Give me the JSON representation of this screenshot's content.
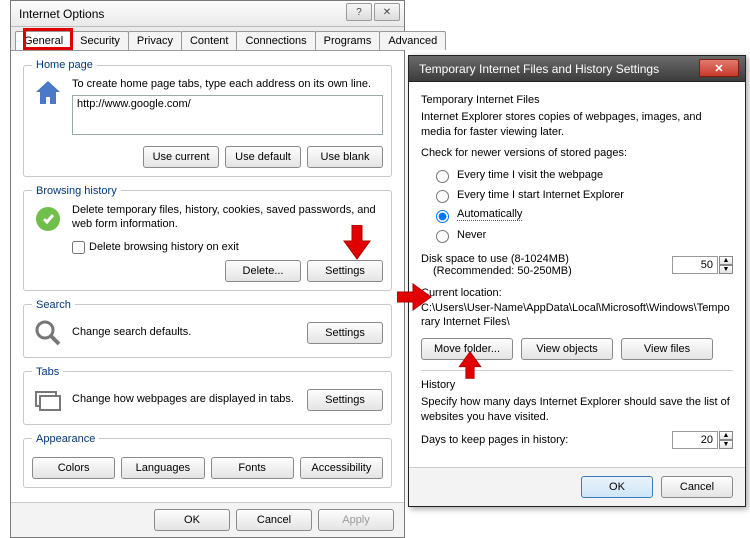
{
  "dlg1": {
    "title": "Internet Options",
    "tabs": [
      "General",
      "Security",
      "Privacy",
      "Content",
      "Connections",
      "Programs",
      "Advanced"
    ],
    "homepage": {
      "legend": "Home page",
      "desc": "To create home page tabs, type each address on its own line.",
      "url": "http://www.google.com/",
      "btn_current": "Use current",
      "btn_default": "Use default",
      "btn_blank": "Use blank"
    },
    "history": {
      "legend": "Browsing history",
      "desc": "Delete temporary files, history, cookies, saved passwords, and web form information.",
      "chk": "Delete browsing history on exit",
      "btn_delete": "Delete...",
      "btn_settings": "Settings"
    },
    "search": {
      "legend": "Search",
      "desc": "Change search defaults.",
      "btn_settings": "Settings"
    },
    "tabsgrp": {
      "legend": "Tabs",
      "desc": "Change how webpages are displayed in tabs.",
      "btn_settings": "Settings"
    },
    "appearance": {
      "legend": "Appearance",
      "btn_colors": "Colors",
      "btn_lang": "Languages",
      "btn_fonts": "Fonts",
      "btn_access": "Accessibility"
    },
    "bottom": {
      "ok": "OK",
      "cancel": "Cancel",
      "apply": "Apply"
    }
  },
  "dlg2": {
    "title": "Temporary Internet Files and History Settings",
    "tif": {
      "heading": "Temporary Internet Files",
      "desc": "Internet Explorer stores copies of webpages, images, and media for faster viewing later.",
      "checklabel": "Check for newer versions of stored pages:",
      "opts": [
        "Every time I visit the webpage",
        "Every time I start Internet Explorer",
        "Automatically",
        "Never"
      ],
      "selected": 2,
      "disk_label": "Disk space to use (8-1024MB)",
      "disk_rec": "(Recommended: 50-250MB)",
      "disk_value": "50",
      "loc_label": "Current location:",
      "loc_path": "C:\\Users\\User-Name\\AppData\\Local\\Microsoft\\Windows\\Temporary Internet Files\\",
      "btn_move": "Move folder...",
      "btn_objects": "View objects",
      "btn_files": "View files"
    },
    "hist": {
      "heading": "History",
      "desc": "Specify how many days Internet Explorer should save the list of websites you have visited.",
      "days_label": "Days to keep pages in history:",
      "days_value": "20"
    },
    "bottom": {
      "ok": "OK",
      "cancel": "Cancel"
    }
  }
}
